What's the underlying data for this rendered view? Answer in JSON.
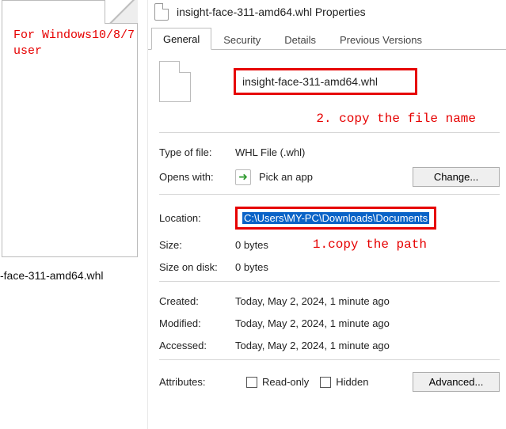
{
  "left": {
    "annotation": "For Windows10/8/7\nuser",
    "file_label": "-face-311-amd64.whl"
  },
  "window": {
    "title": "insight-face-311-amd64.whl Properties"
  },
  "tabs": {
    "general": "General",
    "security": "Security",
    "details": "Details",
    "previous": "Previous Versions"
  },
  "filename": "insight-face-311-amd64.whl",
  "annotations": {
    "step2": "2. copy the file name",
    "step1": "1.copy the path"
  },
  "labels": {
    "type_of_file": "Type of file:",
    "opens_with": "Opens with:",
    "location": "Location:",
    "size": "Size:",
    "size_on_disk": "Size on disk:",
    "created": "Created:",
    "modified": "Modified:",
    "accessed": "Accessed:",
    "attributes": "Attributes:"
  },
  "values": {
    "type_of_file": "WHL File (.whl)",
    "opens_with": "Pick an app",
    "location": "C:\\Users\\MY-PC\\Downloads\\Documents",
    "size": "0 bytes",
    "size_on_disk": "0 bytes",
    "created": "Today, May 2, 2024, 1 minute ago",
    "modified": "Today, May 2, 2024, 1 minute ago",
    "accessed": "Today, May 2, 2024, 1 minute ago"
  },
  "buttons": {
    "change": "Change...",
    "advanced": "Advanced..."
  },
  "attributes": {
    "readonly": "Read-only",
    "hidden": "Hidden"
  }
}
